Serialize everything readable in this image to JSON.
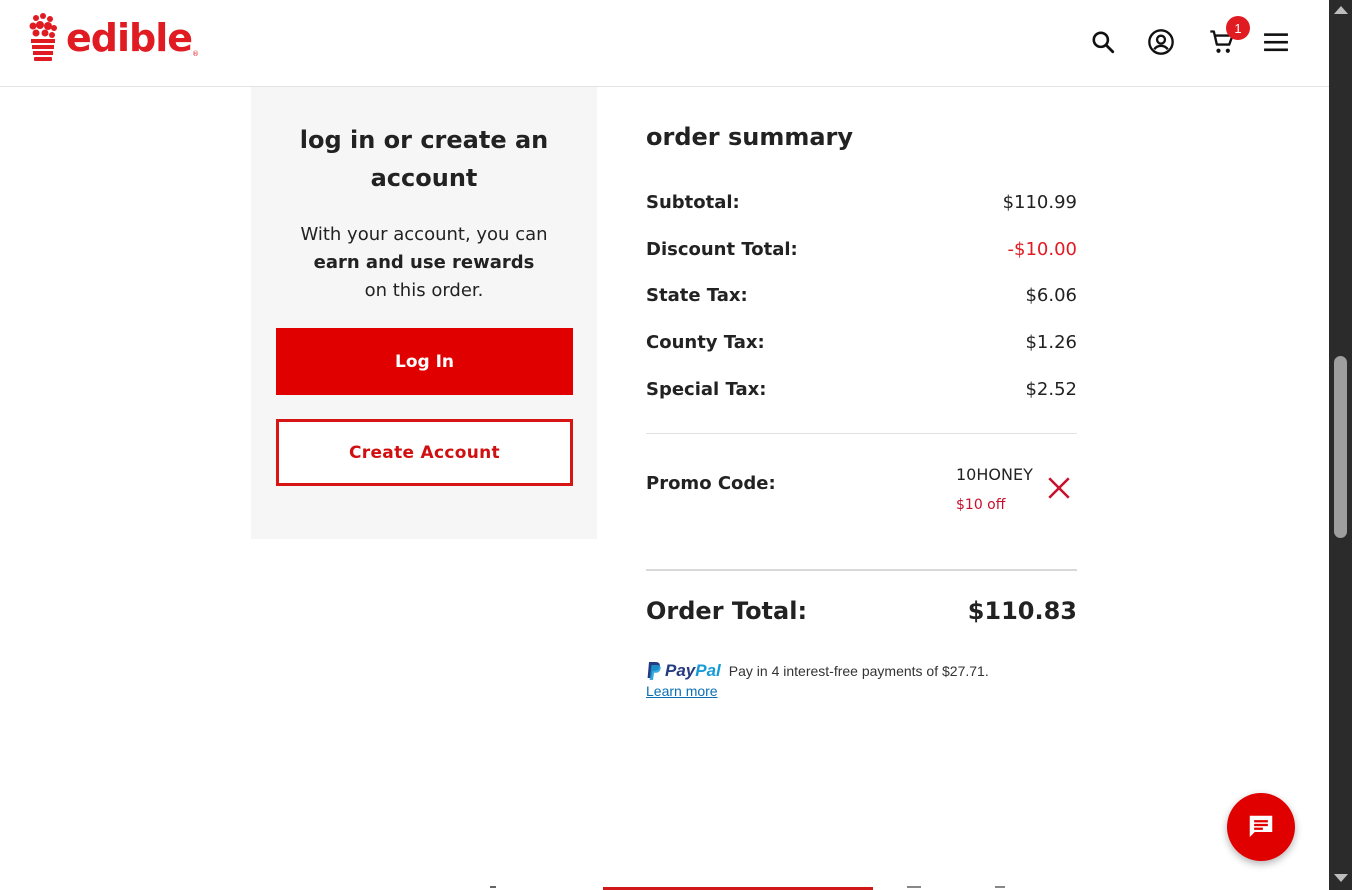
{
  "brand": {
    "logo_text": "edible",
    "trademark": "®",
    "accent": "#e01b22"
  },
  "header": {
    "icons": [
      "search-icon",
      "account-icon",
      "cart-icon",
      "menu-icon"
    ],
    "cart_count": "1"
  },
  "login": {
    "title": "log in or create an account",
    "copy_line1": "With your account, you can",
    "copy_bold": "earn and use rewards",
    "copy_line3": "on this order.",
    "login_label": "Log In",
    "create_label": "Create Account"
  },
  "summary": {
    "title": "order summary",
    "rows": [
      {
        "label": "Subtotal:",
        "value": "$110.99"
      },
      {
        "label": "Discount Total:",
        "value": "-$10.00"
      },
      {
        "label": "State Tax:",
        "value": "$6.06"
      },
      {
        "label": "County Tax:",
        "value": "$1.26"
      },
      {
        "label": "Special Tax:",
        "value": "$2.52"
      }
    ],
    "promo_label": "Promo Code:",
    "promo_code": "10HONEY",
    "promo_off": "$10 off",
    "total_label": "Order Total:",
    "total_value": "$110.83"
  },
  "paypal": {
    "brand_a": "Pay",
    "brand_b": "Pal",
    "message": "Pay in 4 interest-free payments of $27.71.",
    "learn_more": "Learn more"
  }
}
